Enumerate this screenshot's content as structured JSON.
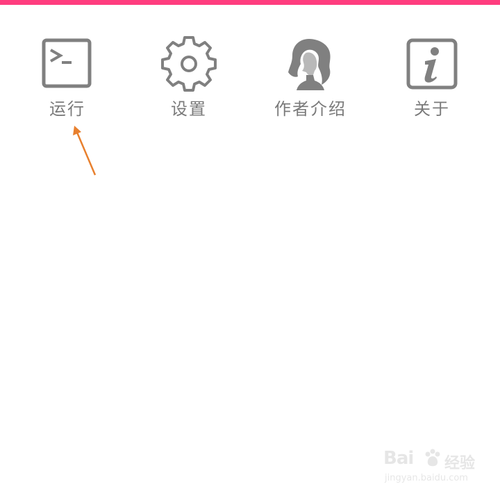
{
  "colors": {
    "top_bar": "#ff3d7f",
    "icon_gray": "#808080",
    "label_gray": "#7a7a7a",
    "annotation": "#e8802e"
  },
  "menu": {
    "items": [
      {
        "label": "运行",
        "icon": "terminal-icon"
      },
      {
        "label": "设置",
        "icon": "gear-icon"
      },
      {
        "label": "作者介绍",
        "icon": "woman-portrait-icon"
      },
      {
        "label": "关于",
        "icon": "info-icon"
      }
    ]
  },
  "watermark": {
    "brand": "Bai",
    "brand_cn": "经验",
    "url": "jingyan.baidu.com"
  }
}
